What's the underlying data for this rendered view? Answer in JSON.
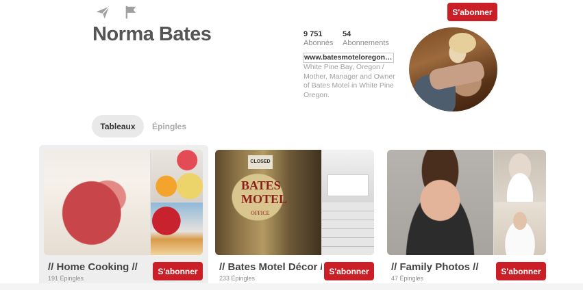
{
  "header": {
    "subscribe_label": "S'abonner"
  },
  "profile": {
    "name": "Norma Bates",
    "followers_count": "9 751",
    "followers_label": "Abonnés",
    "following_count": "54",
    "following_label": "Abonnements",
    "website": "www.batesmoteloregon.com",
    "bio": "White Pine Bay, Oregon / Mother, Manager and Owner of Bates Motel in White Pine Oregon."
  },
  "tabs": [
    {
      "label": "Tableaux",
      "active": true
    },
    {
      "label": "Épingles",
      "active": false
    }
  ],
  "boards": [
    {
      "title": "// Home Cooking //",
      "count": "191 Épingles",
      "button": "S'abonner"
    },
    {
      "title": "// Bates Motel Décor //",
      "count": "233 Épingles",
      "button": "S'abonner"
    },
    {
      "title": "// Family Photos //",
      "count": "47 Épingles",
      "button": "S'abonner"
    }
  ],
  "icons": [
    "send-icon",
    "flag-icon"
  ],
  "colors": {
    "accent": "#cb1f27",
    "tab_active_bg": "#e9e9e9"
  }
}
